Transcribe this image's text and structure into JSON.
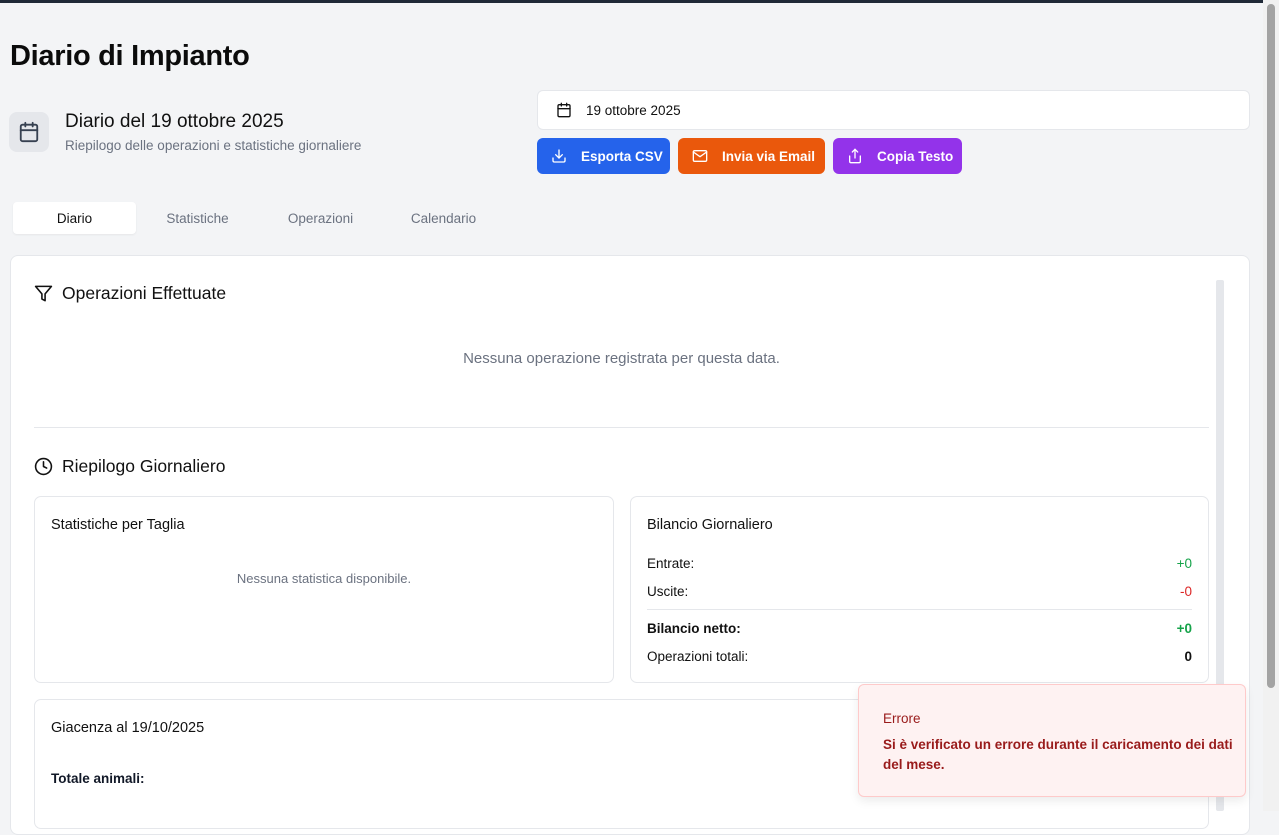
{
  "page": {
    "title": "Diario di Impianto"
  },
  "header": {
    "heading": "Diario del 19 ottobre 2025",
    "subheading": "Riepilogo delle operazioni e statistiche giornaliere",
    "calendar_icon": "calendar-icon"
  },
  "date_picker": {
    "value": "19 ottobre 2025",
    "icon": "calendar-icon"
  },
  "actions": {
    "export_csv": {
      "label": "Esporta CSV",
      "icon": "download-icon",
      "color": "#2563eb"
    },
    "send_email": {
      "label": "Invia via Email",
      "icon": "mail-icon",
      "color": "#ea580c"
    },
    "copy_text": {
      "label": "Copia Testo",
      "icon": "share-icon",
      "color": "#9333ea"
    }
  },
  "tabs": [
    {
      "label": "Diario",
      "active": true
    },
    {
      "label": "Statistiche",
      "active": false
    },
    {
      "label": "Operazioni",
      "active": false
    },
    {
      "label": "Calendario",
      "active": false
    }
  ],
  "operations": {
    "title": "Operazioni Effettuate",
    "icon": "filter-icon",
    "empty_text": "Nessuna operazione registrata per questa data."
  },
  "summary": {
    "title": "Riepilogo Giornaliero",
    "icon": "clock-icon",
    "size_stats": {
      "title": "Statistiche per Taglia",
      "empty_text": "Nessuna statistica disponibile."
    },
    "balance": {
      "title": "Bilancio Giornaliero",
      "rows": [
        {
          "label": "Entrate:",
          "value": "+0",
          "color": "#16a34a"
        },
        {
          "label": "Uscite:",
          "value": "-0",
          "color": "#dc2626"
        },
        {
          "label": "Bilancio netto:",
          "value": "+0",
          "color": "#16a34a"
        },
        {
          "label": "Operazioni totali:",
          "value": "0",
          "color": "#111111"
        }
      ]
    },
    "stock": {
      "title": "Giacenza al 19/10/2025",
      "total_label": "Totale animali:"
    }
  },
  "toast": {
    "title": "Errore",
    "message": "Si è verificato un errore durante il caricamento dei dati del mese.",
    "color": "#991b1b"
  }
}
